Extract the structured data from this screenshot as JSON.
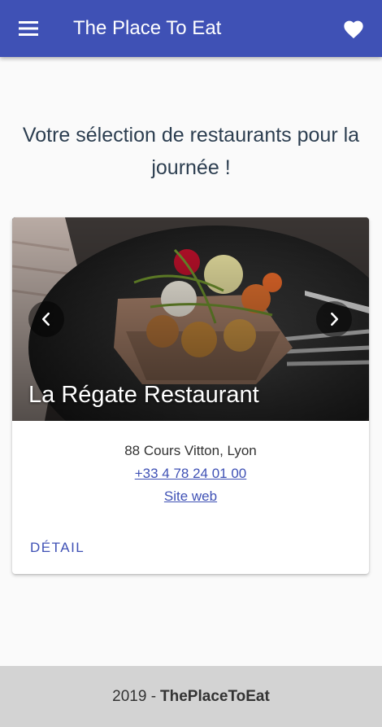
{
  "appbar": {
    "title": "The Place To Eat",
    "menu_icon": "menu-icon",
    "favorite_icon": "heart-icon",
    "color": "#3f51b5"
  },
  "intro": {
    "text": "Votre sélection de restaurants pour la journée !"
  },
  "card": {
    "restaurant_name": "La Régate Restaurant",
    "address": "88 Cours Vitton, Lyon",
    "phone": "+33 4 78 24 01 00",
    "website_label": "Site web",
    "detail_label": "DÉTAIL",
    "prev_icon": "chevron-left-icon",
    "next_icon": "chevron-right-icon"
  },
  "footer": {
    "year_prefix": "2019 -",
    "brand": "ThePlaceToEat"
  }
}
